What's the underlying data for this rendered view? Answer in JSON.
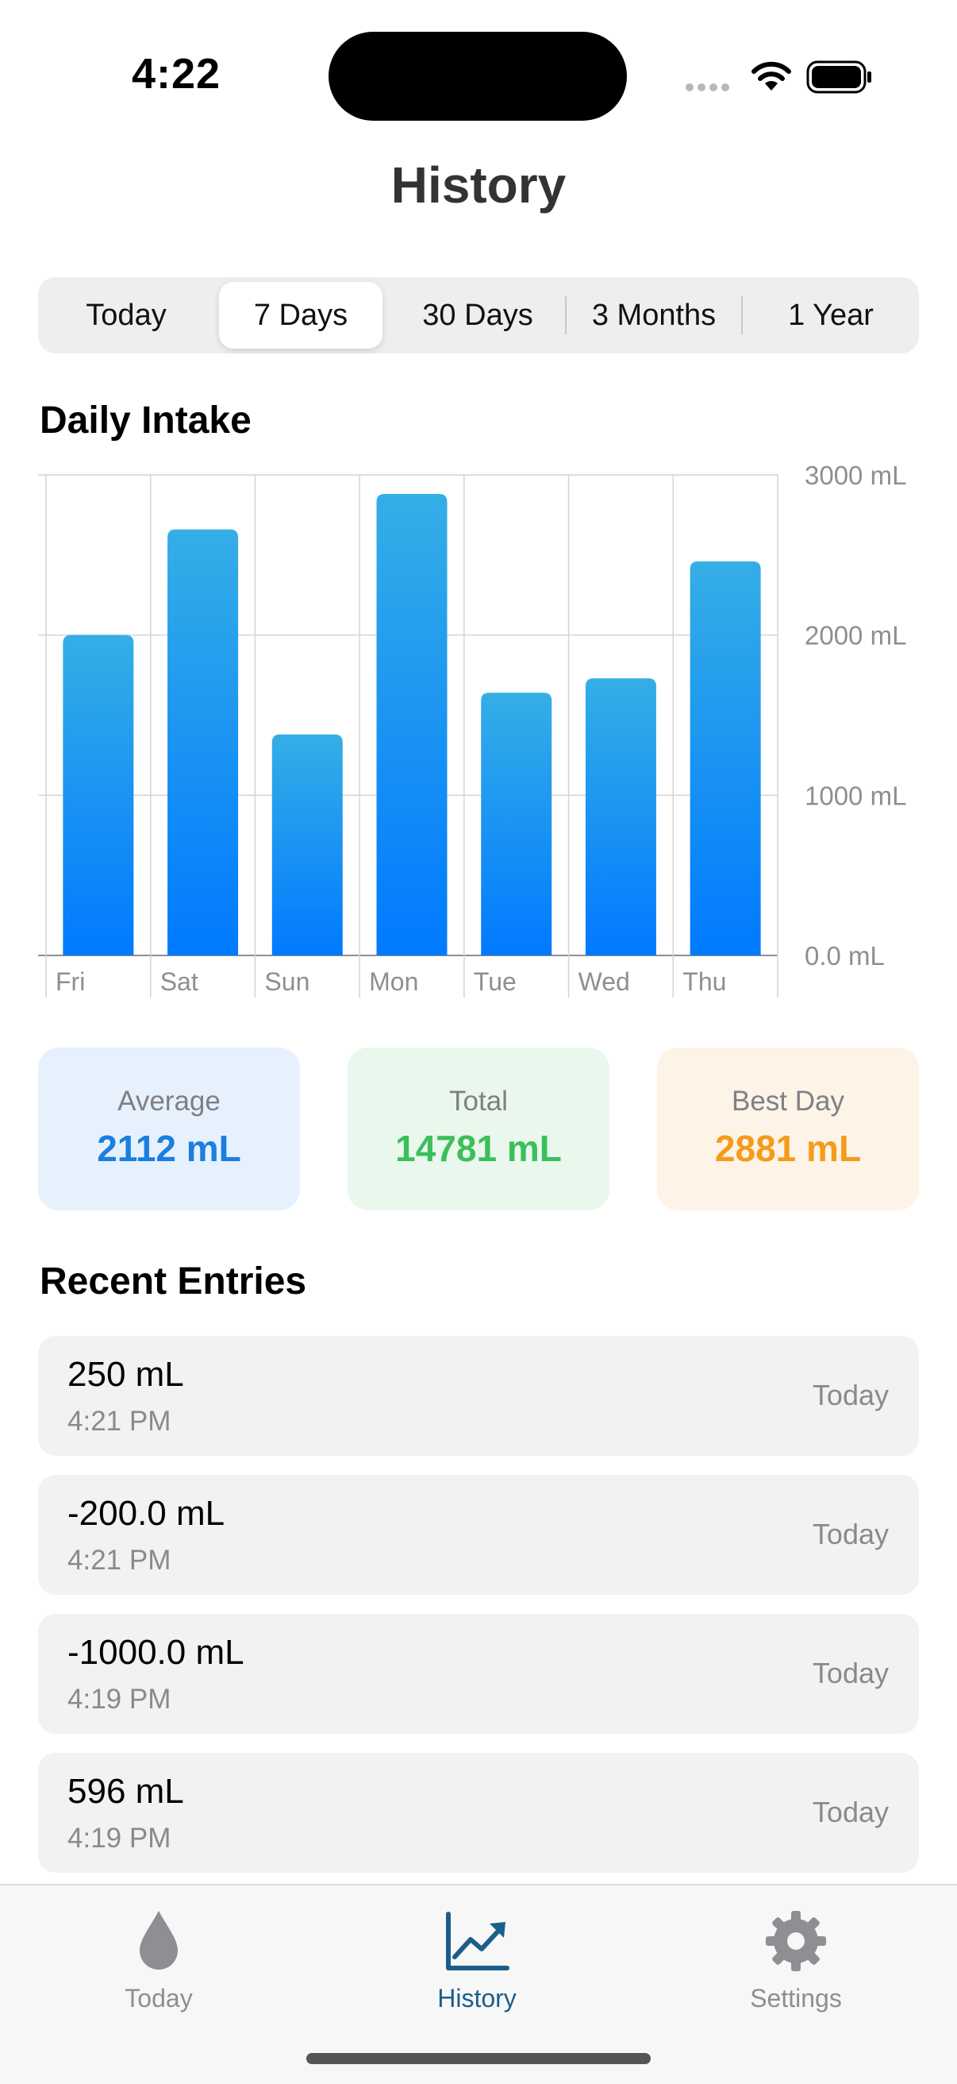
{
  "status_bar": {
    "time": "4:22"
  },
  "header": {
    "title": "History"
  },
  "range_tabs": {
    "items": [
      "Today",
      "7 Days",
      "30 Days",
      "3 Months",
      "1 Year"
    ],
    "selected": "7 Days"
  },
  "daily_intake": {
    "title": "Daily Intake"
  },
  "chart_data": {
    "type": "bar",
    "title": "Daily Intake",
    "categories": [
      "Fri",
      "Sat",
      "Sun",
      "Mon",
      "Tue",
      "Wed",
      "Thu"
    ],
    "values": [
      2000,
      2660,
      1380,
      2881,
      1640,
      1730,
      2460
    ],
    "y_ticks": [
      "0.0 mL",
      "1000 mL",
      "2000 mL",
      "3000 mL"
    ],
    "ylim": [
      0,
      3000
    ],
    "grid": true,
    "y_axis_position": "right",
    "bar_color_top": "#35aee6",
    "bar_color_bottom": "#007aff"
  },
  "stats": {
    "average": {
      "label": "Average",
      "value": "2112 mL",
      "color": "#1a7fe0",
      "bg": "#e6f1fd"
    },
    "total": {
      "label": "Total",
      "value": "14781 mL",
      "color": "#3bbf5a",
      "bg": "#eaf7ed"
    },
    "best_day": {
      "label": "Best Day",
      "value": "2881 mL",
      "color": "#f59b1c",
      "bg": "#fdf3e6"
    }
  },
  "recent": {
    "title": "Recent Entries",
    "entries": [
      {
        "amount": "250 mL",
        "time": "4:21 PM",
        "day": "Today"
      },
      {
        "amount": "-200.0 mL",
        "time": "4:21 PM",
        "day": "Today"
      },
      {
        "amount": "-1000.0 mL",
        "time": "4:19 PM",
        "day": "Today"
      },
      {
        "amount": "596 mL",
        "time": "4:19 PM",
        "day": "Today"
      }
    ]
  },
  "tabbar": {
    "items": [
      {
        "label": "Today",
        "icon": "drop-icon"
      },
      {
        "label": "History",
        "icon": "chart-icon"
      },
      {
        "label": "Settings",
        "icon": "gear-icon"
      }
    ],
    "active": "History",
    "active_color": "#1b5e8a",
    "inactive_color": "#8e8e93"
  }
}
